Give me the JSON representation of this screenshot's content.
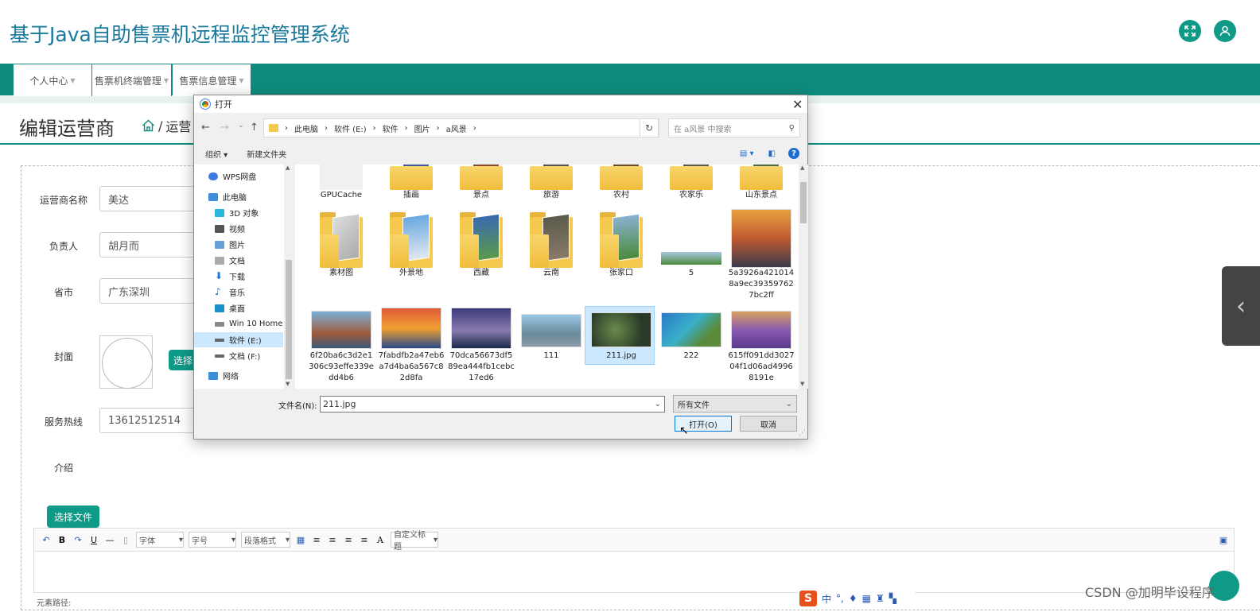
{
  "header": {
    "title": "基于Java自助售票机远程监控管理系统"
  },
  "nav": [
    {
      "label": "个人中心"
    },
    {
      "label": "售票机终端管理"
    },
    {
      "label": "售票信息管理"
    }
  ],
  "page": {
    "heading": "编辑运营商",
    "breadcrumb_sep": "/",
    "breadcrumb_current": "运营"
  },
  "form": {
    "operator_label": "运营商名称",
    "operator_value": "美达",
    "manager_label": "负责人",
    "manager_value": "胡月而",
    "province_label": "省市",
    "province_value": "广东深圳",
    "cover_label": "封面",
    "cover_button": "选择",
    "hotline_label": "服务热线",
    "hotline_value": "13612512514",
    "intro_label": "介绍",
    "choose_file_button": "选择文件"
  },
  "editor": {
    "bold": "B",
    "underline": "U",
    "font": "字体",
    "size": "字号",
    "paragraph": "段落格式",
    "font_color": "A",
    "custom_title": "自定义标题",
    "element_path": "元素路径:"
  },
  "ime": {
    "logo": "S",
    "mode": "中"
  },
  "watermark": "CSDN @加明毕设程序",
  "dialog": {
    "title": "打开",
    "close": "✕",
    "breadcrumbs": [
      "此电脑",
      "软件 (E:)",
      "软件",
      "图片",
      "a风景"
    ],
    "search_placeholder": "在 a风景 中搜索",
    "toolbar": {
      "organize": "组织 ▾",
      "new_folder": "新建文件夹"
    },
    "tree": [
      {
        "label": "WPS网盘",
        "color": "#3d7be0"
      },
      {
        "label": "此电脑",
        "color": "#3a8fd9"
      },
      {
        "label": "3D 对象",
        "color": "#2cb6e0"
      },
      {
        "label": "视频",
        "color": "#555"
      },
      {
        "label": "图片",
        "color": "#6aa0d8"
      },
      {
        "label": "文档",
        "color": "#888"
      },
      {
        "label": "下载",
        "color": "#1c6dd0"
      },
      {
        "label": "音乐",
        "color": "#1c6dd0"
      },
      {
        "label": "桌面",
        "color": "#1c8fd0"
      },
      {
        "label": "Win 10 Home",
        "color": "#666"
      },
      {
        "label": "软件 (E:)",
        "color": "#555"
      },
      {
        "label": "文档 (F:)",
        "color": "#555"
      },
      {
        "label": "网络",
        "color": "#3a8fd9"
      }
    ],
    "files_row1": [
      "GPUCache",
      "插画",
      "景点",
      "旅游",
      "农村",
      "农家乐",
      "山东景点"
    ],
    "files_row2": [
      "素材图",
      "外景地",
      "西藏",
      "云南",
      "张家口",
      "5",
      "5a3926a4210148a9ec393597627bc2ff"
    ],
    "files_row3": [
      "6f20ba6c3d2e1306c93effe339edd4b6",
      "7fabdfb2a47eb6a7d4ba6a567c82d8fa",
      "70dca56673df589ea444fb1cebc17ed6",
      "111",
      "211.jpg",
      "222",
      "615ff091dd302704f1d06ad49968191e"
    ],
    "filename_label": "文件名(N):",
    "filename_value": "211.jpg",
    "filetype_value": "所有文件",
    "open_button": "打开(O)",
    "cancel_button": "取消"
  },
  "colors": {
    "primary": "#0f8c7d",
    "title_blue": "#1a7a9e",
    "selection": "#cce8ff"
  }
}
